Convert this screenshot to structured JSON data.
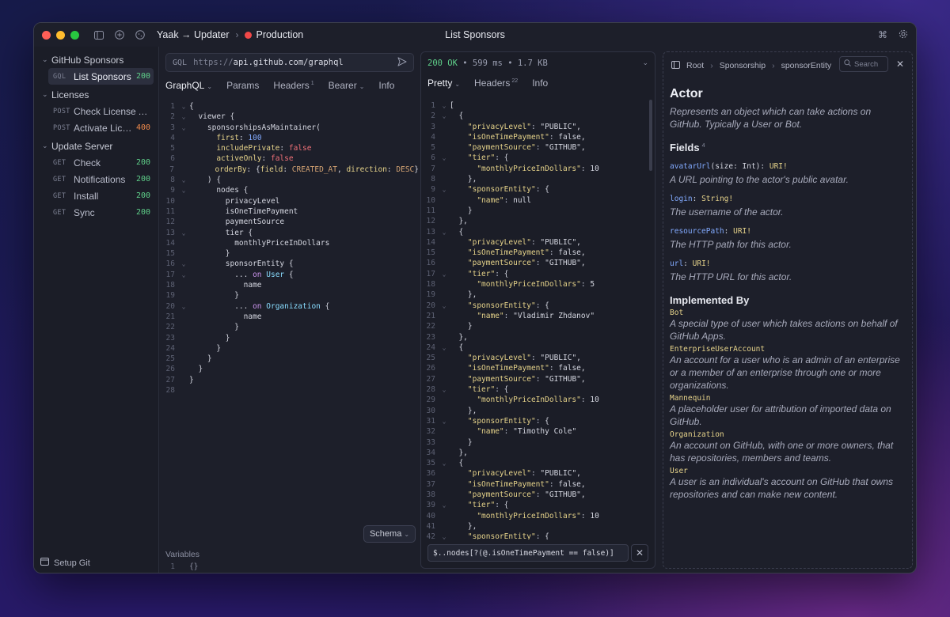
{
  "titlebar": {
    "workspace": "Yaak → Updater",
    "environment": "Production",
    "title": "List Sponsors",
    "env_color": "#f04848"
  },
  "sidebar": {
    "folders": [
      {
        "name": "GitHub Sponsors",
        "items": [
          {
            "method": "GQL",
            "name": "List Sponsors",
            "status": "200",
            "active": true
          }
        ]
      },
      {
        "name": "Licenses",
        "items": [
          {
            "method": "POST",
            "name": "Check License A...",
            "status": ""
          },
          {
            "method": "POST",
            "name": "Activate Lice...",
            "status": "400"
          }
        ]
      },
      {
        "name": "Update Server",
        "items": [
          {
            "method": "GET",
            "name": "Check",
            "status": "200"
          },
          {
            "method": "GET",
            "name": "Notifications",
            "status": "200"
          },
          {
            "method": "GET",
            "name": "Install",
            "status": "200"
          },
          {
            "method": "GET",
            "name": "Sync",
            "status": "200"
          }
        ]
      }
    ],
    "footer": "Setup Git"
  },
  "request": {
    "method": "GQL",
    "url_proto": "https://",
    "url_host": "api.github.com/graphql",
    "tabs": [
      {
        "label": "GraphQL",
        "badge": "",
        "caret": true
      },
      {
        "label": "Params",
        "badge": "",
        "caret": false
      },
      {
        "label": "Headers",
        "badge": "1",
        "caret": false
      },
      {
        "label": "Bearer",
        "badge": "",
        "caret": true
      },
      {
        "label": "Info",
        "badge": "",
        "caret": false
      }
    ],
    "query_lines": [
      "{",
      "  viewer {",
      "    sponsorshipsAsMaintainer(",
      "      first: 100",
      "      includePrivate: false",
      "      activeOnly: false",
      "      orderBy: {field: CREATED_AT, direction: DESC}",
      "    ) {",
      "      nodes {",
      "        privacyLevel",
      "        isOneTimePayment",
      "        paymentSource",
      "        tier {",
      "          monthlyPriceInDollars",
      "        }",
      "        sponsorEntity {",
      "          ... on User {",
      "            name",
      "          }",
      "          ... on Organization {",
      "            name",
      "          }",
      "        }",
      "      }",
      "    }",
      "  }",
      "}",
      ""
    ],
    "schema_label": "Schema",
    "variables_label": "Variables",
    "variables_value": "{}"
  },
  "response": {
    "status": "200 OK",
    "time": "599 ms",
    "size": "1.7 KB",
    "tabs": [
      {
        "label": "Pretty",
        "badge": "",
        "caret": true
      },
      {
        "label": "Headers",
        "badge": "22",
        "caret": false
      },
      {
        "label": "Info",
        "badge": "",
        "caret": false
      }
    ],
    "filter": "$..nodes[?(@.isOneTimePayment == false)]",
    "lines": [
      "[",
      "  {",
      "    \"privacyLevel\": \"PUBLIC\",",
      "    \"isOneTimePayment\": false,",
      "    \"paymentSource\": \"GITHUB\",",
      "    \"tier\": {",
      "      \"monthlyPriceInDollars\": 10",
      "    },",
      "    \"sponsorEntity\": {",
      "      \"name\": null",
      "    }",
      "  },",
      "  {",
      "    \"privacyLevel\": \"PUBLIC\",",
      "    \"isOneTimePayment\": false,",
      "    \"paymentSource\": \"GITHUB\",",
      "    \"tier\": {",
      "      \"monthlyPriceInDollars\": 5",
      "    },",
      "    \"sponsorEntity\": {",
      "      \"name\": \"Vladimir Zhdanov\"",
      "    }",
      "  },",
      "  {",
      "    \"privacyLevel\": \"PUBLIC\",",
      "    \"isOneTimePayment\": false,",
      "    \"paymentSource\": \"GITHUB\",",
      "    \"tier\": {",
      "      \"monthlyPriceInDollars\": 10",
      "    },",
      "    \"sponsorEntity\": {",
      "      \"name\": \"Timothy Cole\"",
      "    }",
      "  },",
      "  {",
      "    \"privacyLevel\": \"PUBLIC\",",
      "    \"isOneTimePayment\": false,",
      "    \"paymentSource\": \"GITHUB\",",
      "    \"tier\": {",
      "      \"monthlyPriceInDollars\": 10",
      "    },",
      "    \"sponsorEntity\": {"
    ]
  },
  "docs": {
    "breadcrumb": [
      "Root",
      "Sponsorship",
      "sponsorEntity"
    ],
    "search_placeholder": "Search",
    "title": "Actor",
    "description": "Represents an object which can take actions on GitHub. Typically a User or Bot.",
    "fields_label": "Fields",
    "fields_count": "4",
    "fields": [
      {
        "name": "avatarUrl",
        "args": "(size: Int)",
        "type": "URI!",
        "desc": "A URL pointing to the actor's public avatar."
      },
      {
        "name": "login",
        "args": "",
        "type": "String!",
        "desc": "The username of the actor."
      },
      {
        "name": "resourcePath",
        "args": "",
        "type": "URI!",
        "desc": "The HTTP path for this actor."
      },
      {
        "name": "url",
        "args": "",
        "type": "URI!",
        "desc": "The HTTP URL for this actor."
      }
    ],
    "implemented_label": "Implemented By",
    "implemented": [
      {
        "name": "Bot",
        "desc": "A special type of user which takes actions on behalf of GitHub Apps."
      },
      {
        "name": "EnterpriseUserAccount",
        "desc": "An account for a user who is an admin of an enterprise or a member of an enterprise through one or more organizations."
      },
      {
        "name": "Mannequin",
        "desc": "A placeholder user for attribution of imported data on GitHub."
      },
      {
        "name": "Organization",
        "desc": "An account on GitHub, with one or more owners, that has repositories, members and teams."
      },
      {
        "name": "User",
        "desc": "A user is an individual's account on GitHub that owns repositories and can make new content."
      }
    ]
  }
}
